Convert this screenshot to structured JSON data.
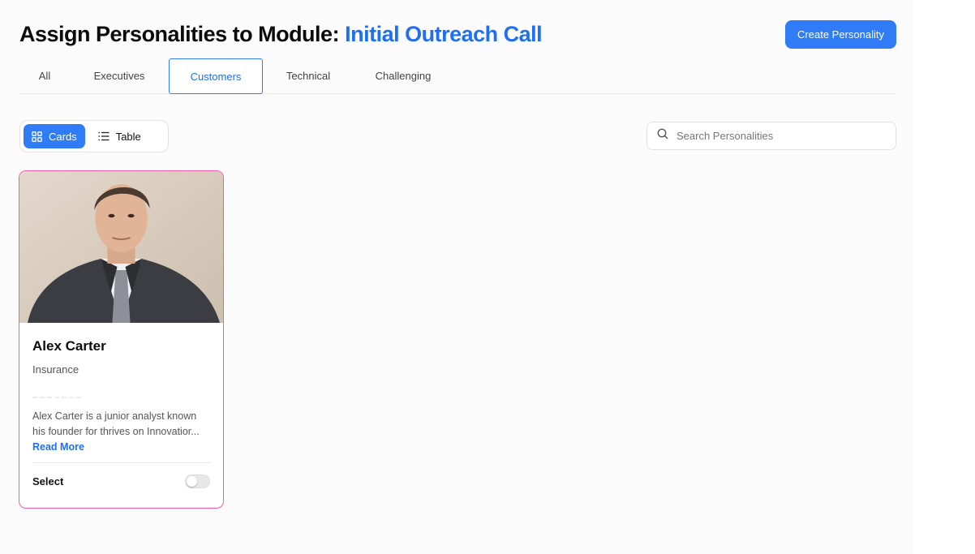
{
  "header": {
    "title_prefix": "Assign Personalities to Module: ",
    "module_name": "Initial Outreach Call",
    "create_button_label": "Create Personality"
  },
  "tabs": [
    {
      "label": "All",
      "active": false
    },
    {
      "label": "Executives",
      "active": false
    },
    {
      "label": "Customers",
      "active": true
    },
    {
      "label": "Technical",
      "active": false
    },
    {
      "label": "Challenging",
      "active": false
    }
  ],
  "view_toggle": {
    "cards_label": "Cards",
    "table_label": "Table",
    "selected": "Cards"
  },
  "search": {
    "placeholder": "Search Personalities",
    "value": ""
  },
  "cards": [
    {
      "name": "Alex Carter",
      "industry": "Insurance",
      "description": "Alex Carter is a junior analyst known his founder for thrives on Innovatior...",
      "read_more_label": "Read More",
      "select_label": "Select",
      "selected": false
    }
  ],
  "colors": {
    "accent": "#2f7cf6",
    "title_accent": "#1f6ff2",
    "card_border": "#ee5fa8"
  }
}
